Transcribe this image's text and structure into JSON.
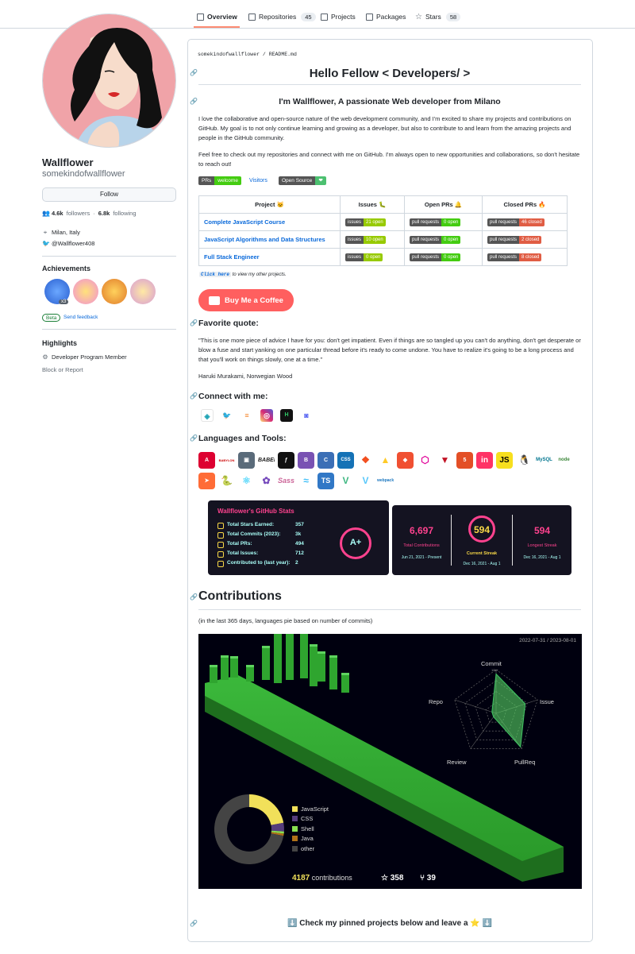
{
  "tabs": [
    {
      "label": "Overview",
      "count": ""
    },
    {
      "label": "Repositories",
      "count": "45"
    },
    {
      "label": "Projects",
      "count": ""
    },
    {
      "label": "Packages",
      "count": ""
    },
    {
      "label": "Stars",
      "count": "58"
    }
  ],
  "profile": {
    "name": "Wallflower",
    "login": "somekindofwallflower",
    "follow_label": "Follow",
    "followers_count": "4.6k",
    "followers_label": "followers",
    "separator": "·",
    "following_count": "6.8k",
    "following_label": "following",
    "location": "Milan, Italy",
    "twitter": "@Wallflower408"
  },
  "achievements": {
    "heading": "Achievements",
    "multiplier": "x3",
    "beta_label": "Beta",
    "feedback_label": "Send feedback"
  },
  "highlights": {
    "heading": "Highlights",
    "item": "Developer Program Member",
    "block_label": "Block or Report"
  },
  "readme": {
    "path_user": "somekindofwallflower",
    "path_sep": "/",
    "path_file": "README.md",
    "title": "Hello Fellow < Developers/ >",
    "subtitle": "I'm Wallflower, A passionate Web developer from Milano",
    "intro": "I love the collaborative and open-source nature of the web development community, and I'm excited to share my projects and contributions on GitHub. My goal is to not only continue learning and growing as a developer, but also to contribute to and learn from the amazing projects and people in the GitHub community.",
    "intro2": "Feel free to check out my repositories and connect with me on GitHub. I'm always open to new opportunities and collaborations, so don't hesitate to reach out!",
    "badge_prs_label": "PRs",
    "badge_prs_value": "welcome",
    "badge_visitors": "Visitors",
    "badge_os_label": "Open Source",
    "badge_os_value": "❤",
    "click_here": "Click here",
    "click_rest": "to view my other projects.",
    "coffee": "Buy Me a Coffee",
    "quote_heading": "Favorite quote:",
    "quote": "\"This is one more piece of advice I have for you: don't get impatient. Even if things are so tangled up you can't do anything, don't get desperate or blow a fuse and start yanking on one particular thread before it's ready to come undone. You have to realize it's going to be a long process and that you'll work on things slowly, one at a time.\"",
    "quote_author": "Haruki Murakami, Norwegian Wood",
    "connect_heading": "Connect with me:",
    "languages_heading": "Languages and Tools:",
    "contrib_heading": "Contributions",
    "contrib_note": "(in the last 365 days, languages pie based on number of commits)",
    "pinned": "⬇️ Check my pinned projects below and leave a ⭐ ⬇️"
  },
  "projects_table": {
    "headers": [
      "Project 🐱",
      "Issues 🐛",
      "Open PRs 🔔",
      "Closed PRs 🔥"
    ],
    "rows": [
      {
        "name": "Complete JavaScript Course",
        "issues": "21 open",
        "open_prs": "0 open",
        "closed_prs": "46 closed"
      },
      {
        "name": "JavaScript Algorithms and Data Structures",
        "issues": "10 open",
        "open_prs": "0 open",
        "closed_prs": "2 closed"
      },
      {
        "name": "Full Stack Engineer",
        "issues": "0 open",
        "open_prs": "0 open",
        "closed_prs": "8 closed"
      }
    ],
    "issues_label": "issues",
    "prs_label": "pull requests"
  },
  "stats_card": {
    "title": "Wallflower's GitHub Stats",
    "rows": [
      {
        "label": "Total Stars Earned:",
        "value": "357"
      },
      {
        "label": "Total Commits (2023):",
        "value": "3k"
      },
      {
        "label": "Total PRs:",
        "value": "494"
      },
      {
        "label": "Total Issues:",
        "value": "712"
      },
      {
        "label": "Contributed to (last year):",
        "value": "2"
      }
    ],
    "grade": "A+"
  },
  "streak_card": {
    "total_value": "6,697",
    "total_label": "Total Contributions",
    "total_range": "Jun 21, 2021 - Present",
    "current_value": "594",
    "current_label": "Current Streak",
    "current_range": "Dec 16, 2021 - Aug 1",
    "longest_value": "594",
    "longest_label": "Longest Streak",
    "longest_range": "Dec 16, 2021 - Aug 1"
  },
  "contrib_chart": {
    "date_range": "2022-07-31 / 2023-08-01",
    "radar_labels": [
      "Commit",
      "Issue",
      "PullReq",
      "Review",
      "Repo"
    ],
    "radar_max": "10k+",
    "radar_values": [
      0.9,
      0.7,
      0.95,
      0.1,
      0.1
    ],
    "languages": [
      {
        "name": "JavaScript",
        "color": "#f1e05a",
        "share": 0.22
      },
      {
        "name": "CSS",
        "color": "#563d7c",
        "share": 0.04
      },
      {
        "name": "Shell",
        "color": "#89e051",
        "share": 0.01
      },
      {
        "name": "Java",
        "color": "#b07219",
        "share": 0.01
      },
      {
        "name": "other",
        "color": "#444444",
        "share": 0.72
      }
    ],
    "contributions_value": "4187",
    "contributions_label": "contributions",
    "stars": "358",
    "forks": "39"
  },
  "colors": {
    "accent": "#0969da",
    "tab_underline": "#fd8c73",
    "card_bg": "#141321",
    "card_pink": "#fe428e",
    "card_cyan": "#a9fef7",
    "card_yellow": "#f8d847",
    "green": "#30a130"
  }
}
